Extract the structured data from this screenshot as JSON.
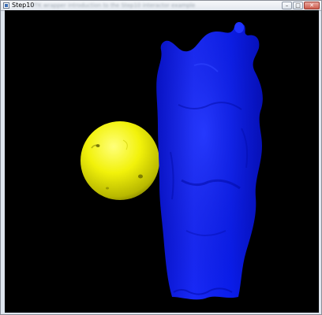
{
  "window": {
    "title": "Step10",
    "subtitle_blurred": "VTK wrapper introduction to the Step10 interactor example"
  },
  "controls": {
    "minimize_glyph": "–",
    "maximize_glyph": "□",
    "close_glyph": "✕"
  },
  "scene": {
    "background_color": "#000000",
    "sphere_color": "#f2f20a",
    "mesh_color": "#0a1ef0"
  }
}
